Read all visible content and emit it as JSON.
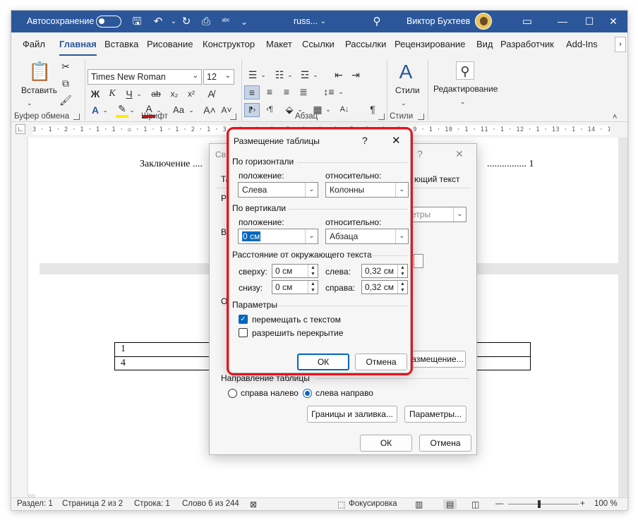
{
  "titlebar": {
    "autosave": "Автосохранение",
    "doc_name": "russ...",
    "user": "Виктор Бухтеев"
  },
  "tabs": [
    "Файл",
    "Главная",
    "Вставка",
    "Рисование",
    "Конструктор",
    "Макет",
    "Ссылки",
    "Рассылки",
    "Рецензирование",
    "Вид",
    "Разработчик",
    "Add-Ins"
  ],
  "ribbon": {
    "paste_label": "Вставить",
    "clipboard_label": "Буфер обмена",
    "font_name": "Times New Roman",
    "font_size": "12",
    "font_label": "Шрифт",
    "paragraph_label": "Абзац",
    "styles_btn": "Стили",
    "styles_label": "Стили",
    "editing_btn": "Редактирование"
  },
  "ruler_text": "3 · 1 · 2 · 1 · 1 · 1 · ⌂ · 1 · 1 · 1 · 2 · 1 · 3 · 1 · 4 · 1 · 5 · 1 · 6 · 1 · 7 · 1 · 8 · 1 · 9 · 1 · 10 · 1 · 11 · 1 · 12 · 1 · 13 · 1 · 14 · 1 · 15 · 16 · 1 · 17 · 1 · 18 ·",
  "document": {
    "toc_line_left": "Заключение ....",
    "toc_line_right": "................ 1",
    "cell_1": "1",
    "cell_4": "4"
  },
  "status": {
    "section": "Раздел: 1",
    "page": "Страница 2 из 2",
    "line": "Строка: 1",
    "words": "Слово 6 из 244",
    "focus": "Фокусировка",
    "zoom": "100 %"
  },
  "back_dialog": {
    "title_fragment": "Св",
    "tab_fragment_left": "Та",
    "tab_fragment_right": "ющий текст",
    "r_fragment": "Р",
    "v_fragment": "Вы",
    "o_fragment": "О",
    "params_fragment": "етры",
    "placement_btn": "азмещение...",
    "direction_label": "Направление таблицы",
    "rtl": "справа налево",
    "ltr": "слева направо",
    "borders_btn": "Границы и заливка...",
    "params_btn": "Параметры...",
    "ok": "ОК",
    "cancel": "Отмена"
  },
  "front_dialog": {
    "title": "Размещение таблицы",
    "help": "?",
    "horizontal_section": "По горизонтали",
    "h_position_label": "положение:",
    "h_position_value": "Слева",
    "h_relative_label": "относительно:",
    "h_relative_value": "Колонны",
    "vertical_section": "По вертикали",
    "v_position_label": "положение:",
    "v_position_value": "0 см",
    "v_relative_label": "относительно:",
    "v_relative_value": "Абзаца",
    "distance_section": "Расстояние от окружающего текста",
    "top_label": "сверху:",
    "top_value": "0 см",
    "bottom_label": "снизу:",
    "bottom_value": "0 см",
    "left_label": "слева:",
    "left_value": "0,32 см",
    "right_label": "справа:",
    "right_value": "0,32 см",
    "params_section": "Параметры",
    "move_with_text": "перемещать с текстом",
    "move_with_text_checked": true,
    "allow_overlap": "разрешить перекрытие",
    "allow_overlap_checked": false,
    "ok": "ОК",
    "cancel": "Отмена"
  },
  "colors": {
    "titlebar": "#2b579a",
    "accent": "#0067c0",
    "highlight": "#e8141c"
  }
}
